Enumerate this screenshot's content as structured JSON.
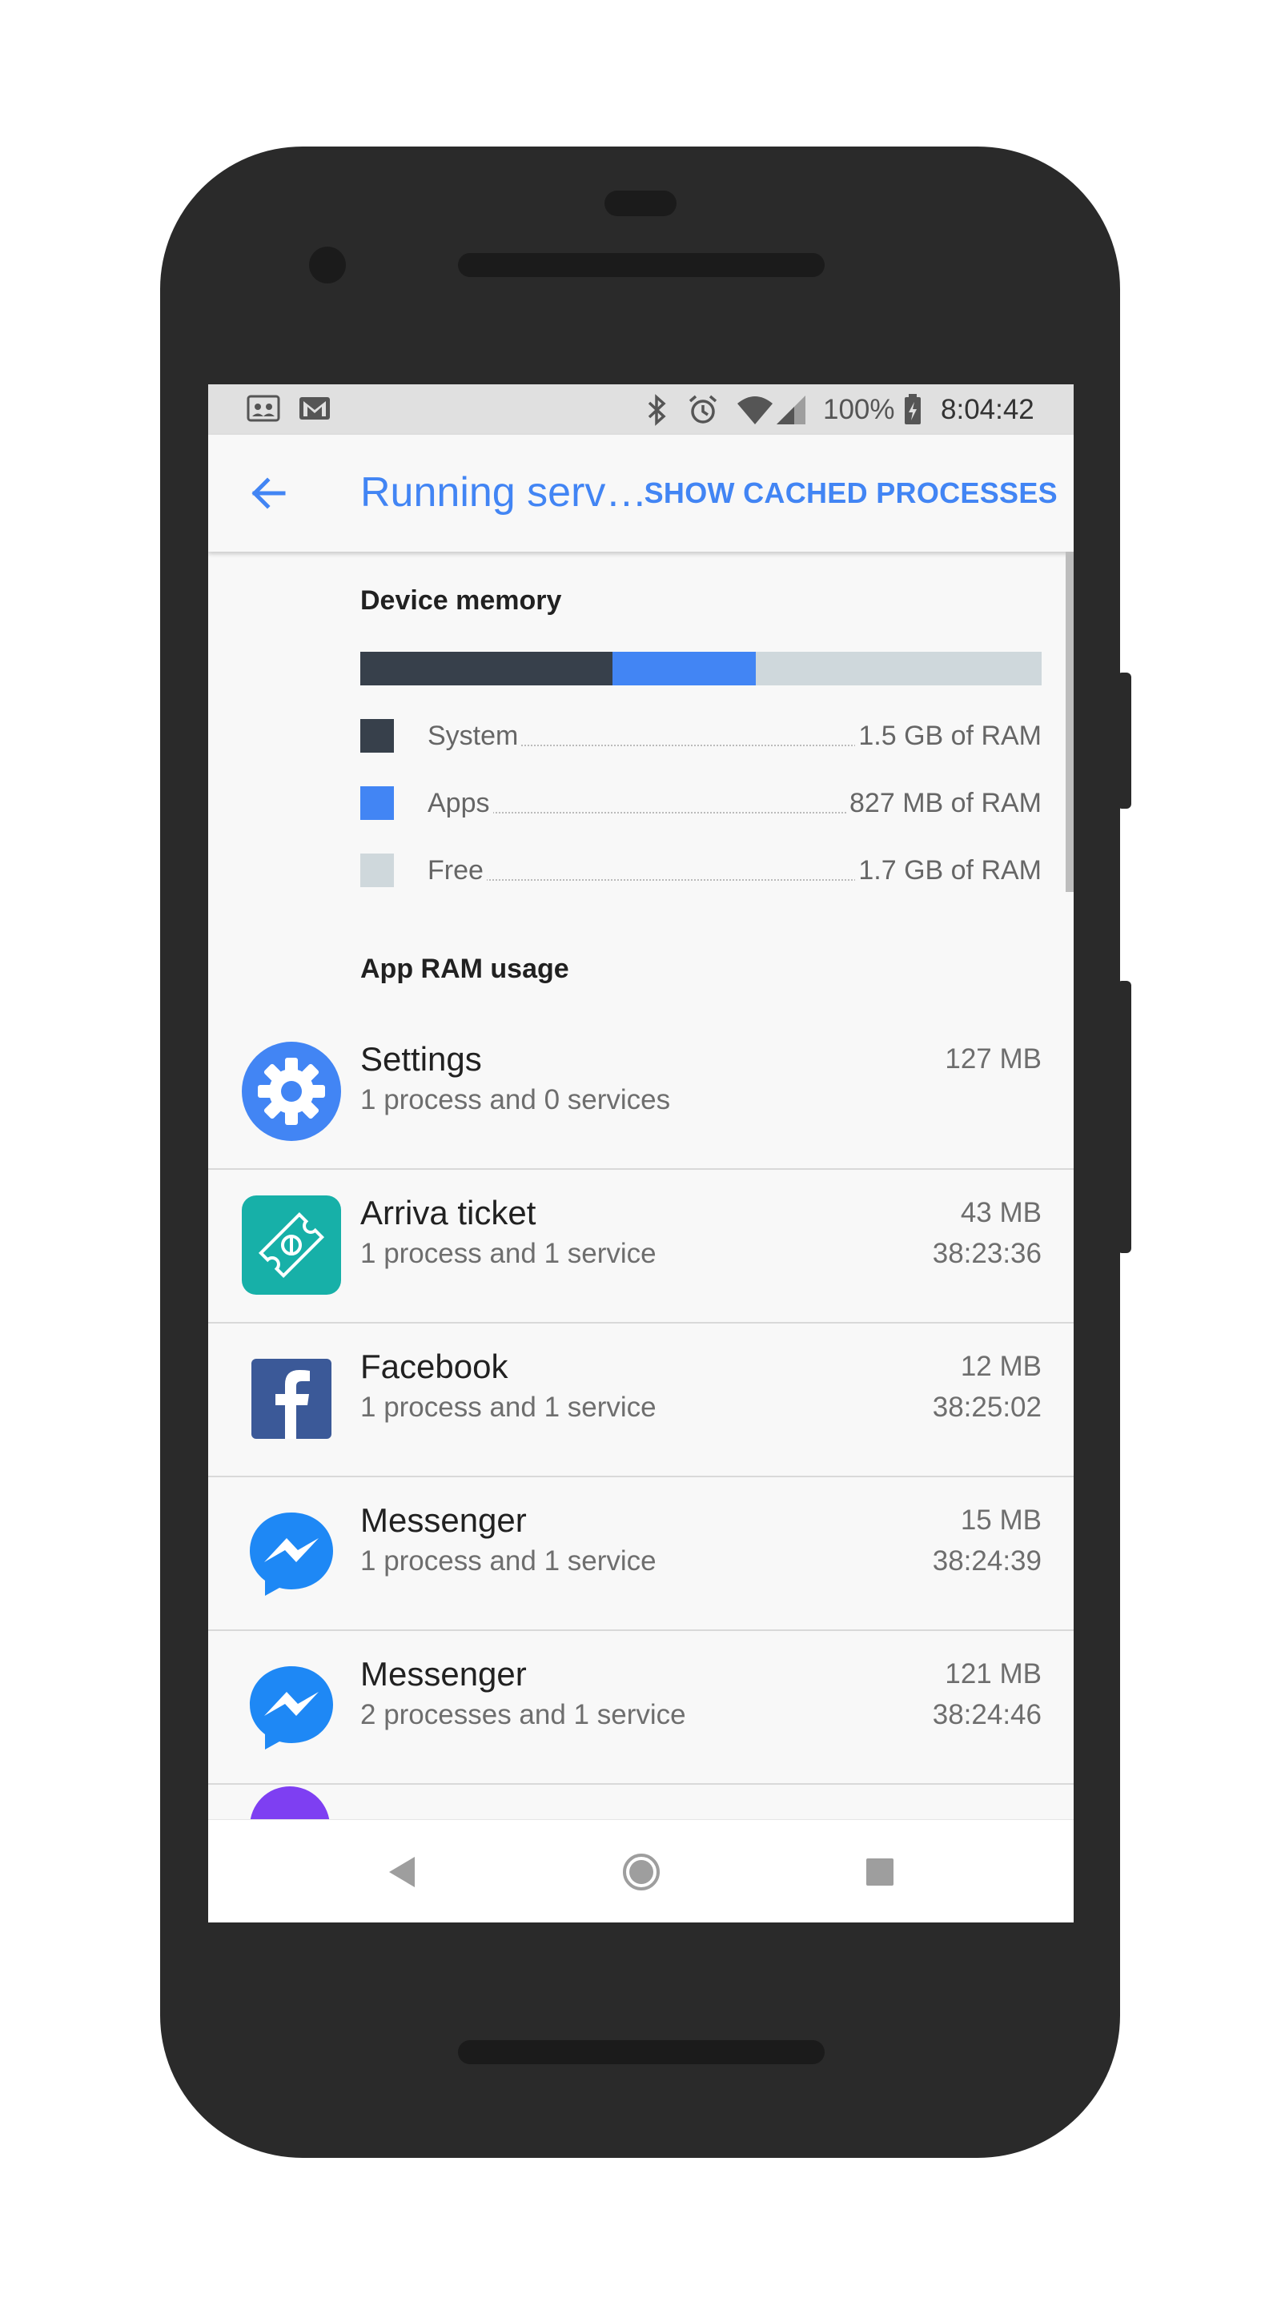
{
  "status_bar": {
    "icons": [
      "photos-notification-icon",
      "gmail-notification-icon",
      "bluetooth-icon",
      "alarm-icon",
      "wifi-icon",
      "cell-signal-icon",
      "battery-charging-icon"
    ],
    "battery": "100%",
    "time": "8:04:42"
  },
  "app_bar": {
    "title": "Running serv…",
    "action_label": "SHOW CACHED PROCESSES"
  },
  "device_memory": {
    "title": "Device memory",
    "bar": [
      {
        "name": "System",
        "fraction": 0.37,
        "color": "#37404b"
      },
      {
        "name": "Apps",
        "fraction": 0.21,
        "color": "#4285f4"
      },
      {
        "name": "Free",
        "fraction": 0.42,
        "color": "#cfd8dc"
      }
    ],
    "legend": [
      {
        "label": "System",
        "value": "1.5 GB of RAM",
        "color": "#37404b"
      },
      {
        "label": "Apps",
        "value": "827 MB of RAM",
        "color": "#4285f4"
      },
      {
        "label": "Free",
        "value": "1.7 GB of RAM",
        "color": "#cfd8dc"
      }
    ]
  },
  "app_ram": {
    "title": "App RAM usage",
    "apps": [
      {
        "name": "Settings",
        "sub": "1 process and 0 services",
        "size": "127 MB",
        "time": "",
        "icon": "settings-icon"
      },
      {
        "name": "Arriva ticket",
        "sub": "1 process and 1 service",
        "size": "43 MB",
        "time": "38:23:36",
        "icon": "arriva-ticket-icon"
      },
      {
        "name": "Facebook",
        "sub": "1 process and 1 service",
        "size": "12 MB",
        "time": "38:25:02",
        "icon": "facebook-icon"
      },
      {
        "name": "Messenger",
        "sub": "1 process and 1 service",
        "size": "15 MB",
        "time": "38:24:39",
        "icon": "messenger-icon"
      },
      {
        "name": "Messenger",
        "sub": "2 processes and 1 service",
        "size": "121 MB",
        "time": "38:24:46",
        "icon": "messenger-icon"
      }
    ]
  },
  "nav_bar": {
    "icons": [
      "back-icon",
      "home-icon",
      "recents-icon"
    ]
  },
  "colors": {
    "accent": "#4285f4",
    "system": "#37404b",
    "free": "#cfd8dc",
    "phone_body": "#2a2a2a"
  }
}
